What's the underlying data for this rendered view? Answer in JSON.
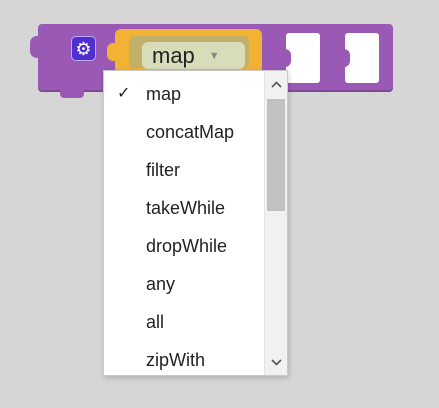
{
  "block": {
    "color": "#9b59b6",
    "gear_icon": "gear-icon",
    "selected_value": "map",
    "arrow": "▼"
  },
  "dropdown": {
    "items": [
      {
        "label": "map",
        "selected": true
      },
      {
        "label": "concatMap",
        "selected": false
      },
      {
        "label": "filter",
        "selected": false
      },
      {
        "label": "takeWhile",
        "selected": false
      },
      {
        "label": "dropWhile",
        "selected": false
      },
      {
        "label": "any",
        "selected": false
      },
      {
        "label": "all",
        "selected": false
      },
      {
        "label": "zipWith",
        "selected": false
      }
    ],
    "check_mark": "✓",
    "scroll_up_icon": "chevron-up-icon",
    "scroll_down_icon": "chevron-down-icon"
  }
}
